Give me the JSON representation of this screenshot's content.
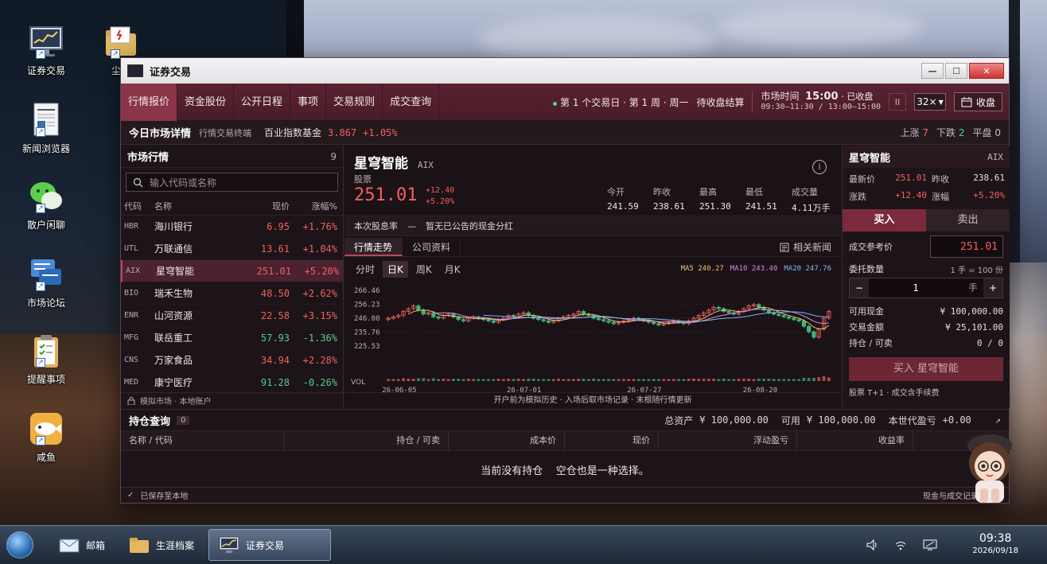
{
  "desktop": {
    "icons": [
      {
        "label": "证券交易",
        "icon": "chart-monitor-icon"
      },
      {
        "label": "尘封",
        "icon": "folder-icon"
      },
      {
        "label": "新闻浏览器",
        "icon": "news-document-icon"
      },
      {
        "label": "散户闲聊",
        "icon": "wechat-bubble-icon"
      },
      {
        "label": "市场论坛",
        "icon": "forum-icon"
      },
      {
        "label": "提醒事项",
        "icon": "clipboard-icon"
      },
      {
        "label": "咸鱼",
        "icon": "fish-icon"
      }
    ]
  },
  "window": {
    "title": "证券交易",
    "controls": {
      "minimize": "—",
      "maximize": "☐",
      "close": "✕"
    }
  },
  "menubar": {
    "items": [
      "行情报价",
      "资金股份",
      "公开日程",
      "事项",
      "交易规则",
      "成交查询"
    ],
    "active_index": 0,
    "session": "第 1 个交易日 · 第 1 周 · 周一",
    "pending": "待收盘结算",
    "market_time_label": "市场时间",
    "market_time": "15:00",
    "market_state": "· 已收盘",
    "market_hours": "09:30–11:30 / 13:00–15:00",
    "pause_label": "II",
    "speed": "32×",
    "close_market_label": "收盘"
  },
  "summary": {
    "title": "今日市场详情",
    "subtitle": "行情交易终端",
    "fund_name": "百业指数基金",
    "fund_price": "3.867",
    "fund_change": "+1.05%",
    "up_label": "上涨",
    "up_count": "7",
    "down_label": "下跌",
    "down_count": "2",
    "flat_label": "平盘",
    "flat_count": "0"
  },
  "market": {
    "title": "市场行情",
    "count": "9",
    "search_placeholder": "输入代码或名称",
    "columns": [
      "代码",
      "名称",
      "现价",
      "涨幅%"
    ],
    "rows": [
      {
        "code": "HBR",
        "name": "海川银行",
        "price": "6.95",
        "change": "+1.76%",
        "dir": "up"
      },
      {
        "code": "UTL",
        "name": "万联通信",
        "price": "13.61",
        "change": "+1.04%",
        "dir": "up"
      },
      {
        "code": "AIX",
        "name": "星穹智能",
        "price": "251.01",
        "change": "+5.20%",
        "dir": "up"
      },
      {
        "code": "BIO",
        "name": "瑞禾生物",
        "price": "48.50",
        "change": "+2.62%",
        "dir": "up"
      },
      {
        "code": "ENR",
        "name": "山河资源",
        "price": "22.58",
        "change": "+3.15%",
        "dir": "up"
      },
      {
        "code": "MFG",
        "name": "联岳重工",
        "price": "57.93",
        "change": "-1.36%",
        "dir": "down"
      },
      {
        "code": "CNS",
        "name": "万家食品",
        "price": "34.94",
        "change": "+2.28%",
        "dir": "up"
      },
      {
        "code": "MED",
        "name": "康宁医疗",
        "price": "91.28",
        "change": "-0.26%",
        "dir": "down"
      }
    ],
    "selected_index": 2,
    "footer": "模拟市场 · 本地账户"
  },
  "stock": {
    "name": "星穹智能",
    "code": "AIX",
    "type": "股票",
    "price": "251.01",
    "change": "+12.40",
    "change_pct": "+5.20%",
    "stats": [
      {
        "label": "今开",
        "value": "241.59",
        "dir": "flat"
      },
      {
        "label": "昨收",
        "value": "238.61",
        "dir": "flat"
      },
      {
        "label": "最高",
        "value": "251.30",
        "dir": "up"
      },
      {
        "label": "最低",
        "value": "241.51",
        "dir": "down"
      },
      {
        "label": "成交量",
        "value": "4.11万手",
        "dir": "flat"
      }
    ],
    "dividend_label": "本次股息率",
    "dividend_value": "—",
    "dividend_note": "暂无已公告的现金分红",
    "tabs": [
      "行情走势",
      "公司资料"
    ],
    "news_label": "相关新闻",
    "periods": [
      "分时",
      "日K",
      "周K",
      "月K"
    ],
    "active_period": 1,
    "ma": [
      {
        "label": "MA5 240.27",
        "color": "#e8c36a"
      },
      {
        "label": "MA10 243.40",
        "color": "#d889e8"
      },
      {
        "label": "MA20 247.76",
        "color": "#7fb7f0"
      }
    ],
    "footer_note": "开户前为模拟历史 · 入场后取市场记录 · 末根随行情更新"
  },
  "chart_data": {
    "type": "candlestick",
    "y_ticks": [
      "266.46",
      "256.23",
      "246.00",
      "235.76",
      "225.53"
    ],
    "ylim": [
      225.53,
      266.46
    ],
    "x_ticks": [
      "26-06-05",
      "26-07-01",
      "26-07-27",
      "26-08-20"
    ],
    "volume_label": "VOL",
    "close": [
      246,
      247,
      248,
      251,
      253,
      255,
      252,
      249,
      250,
      247,
      246,
      248,
      249,
      247,
      245,
      244,
      246,
      247,
      246,
      245,
      244,
      243,
      245,
      246,
      248,
      247,
      249,
      250,
      248,
      246,
      245,
      244,
      243,
      244,
      246,
      247,
      248,
      249,
      251,
      249,
      248,
      246,
      245,
      244,
      243,
      242,
      243,
      244,
      245,
      246,
      245,
      244,
      243,
      242,
      241,
      242,
      243,
      244,
      243,
      242,
      244,
      246,
      248,
      250,
      252,
      254,
      253,
      251,
      250,
      249,
      251,
      253,
      255,
      256,
      254,
      252,
      250,
      249,
      248,
      247,
      246,
      245,
      244,
      240,
      236,
      232,
      238,
      246,
      251
    ]
  },
  "trade": {
    "title": "星穹智能",
    "code": "AIX",
    "last_label": "最新价",
    "last": "251.01",
    "prev_label": "昨收",
    "prev": "238.61",
    "chg_label": "涨跌",
    "chg": "+12.40",
    "pct_label": "涨幅",
    "pct": "+5.20%",
    "buy_tab": "买入",
    "sell_tab": "卖出",
    "ref_price_label": "成交参考价",
    "ref_price": "251.01",
    "qty_label": "委托数量",
    "lot_note": "1 手 = 100 份",
    "qty": "1",
    "qty_unit": "手",
    "cash_label": "可用现金",
    "cash": "¥ 100,000.00",
    "amount_label": "交易金额",
    "amount": "¥ 25,101.00",
    "hold_label": "持仓 / 可卖",
    "hold": "0 / 0",
    "buy_button": "买入 星穹智能",
    "rule_note": "股票 T+1 · 成交含手续费"
  },
  "holdings": {
    "title": "持仓查询",
    "count": "0",
    "total_label": "总资产",
    "total": "¥ 100,000.00",
    "avail_label": "可用",
    "avail": "¥ 100,000.00",
    "pnl_label": "本世代盈亏",
    "pnl": "+0.00",
    "columns": [
      "名称 / 代码",
      "持仓 / 可卖",
      "成本价",
      "现价",
      "浮动盈亏",
      "收益率"
    ],
    "empty_text": "当前没有持仓    空仓也是一种选择。"
  },
  "statusbar": {
    "left": "已保存至本地",
    "right": "现金与成交记录可在账"
  },
  "taskbar": {
    "items": [
      "邮箱",
      "生涯档案",
      "证券交易"
    ],
    "active_index": 2,
    "time": "09:38",
    "date": "2026/09/18"
  }
}
